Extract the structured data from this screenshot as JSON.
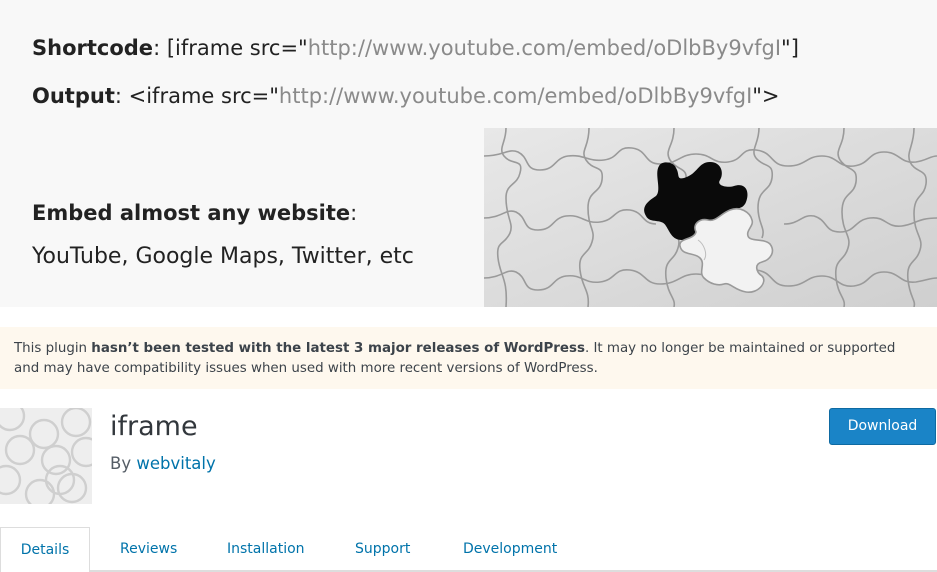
{
  "banner": {
    "shortcode_label": "Shortcode",
    "shortcode_prefix": ": [iframe src=\"",
    "shortcode_url": "http://www.youtube.com/embed/oDlbBy9vfgI",
    "shortcode_suffix": "\"]",
    "output_label": "Output",
    "output_prefix": ": <iframe src=\"",
    "output_url": "http://www.youtube.com/embed/oDlbBy9vfgI",
    "output_suffix": "\">",
    "embed_heading": "Embed almost any website",
    "embed_colon": ":",
    "embed_examples": "YouTube, Google Maps, Twitter, etc"
  },
  "notice": {
    "text_before": "This plugin ",
    "text_strong": "hasn’t been tested with the latest 3 major releases of WordPress",
    "text_after": ". It may no longer be maintained or supported and may have compatibility issues when used with more recent versions of WordPress."
  },
  "plugin": {
    "title": "iframe",
    "by_prefix": "By ",
    "author": "webvitaly",
    "download_label": "Download"
  },
  "tabs": [
    {
      "label": "Details",
      "active": true
    },
    {
      "label": "Reviews",
      "active": false
    },
    {
      "label": "Installation",
      "active": false
    },
    {
      "label": "Support",
      "active": false
    },
    {
      "label": "Development",
      "active": false
    }
  ],
  "colors": {
    "link": "#0073aa",
    "button": "#1a84c7",
    "notice_bg": "#fef8ee"
  }
}
